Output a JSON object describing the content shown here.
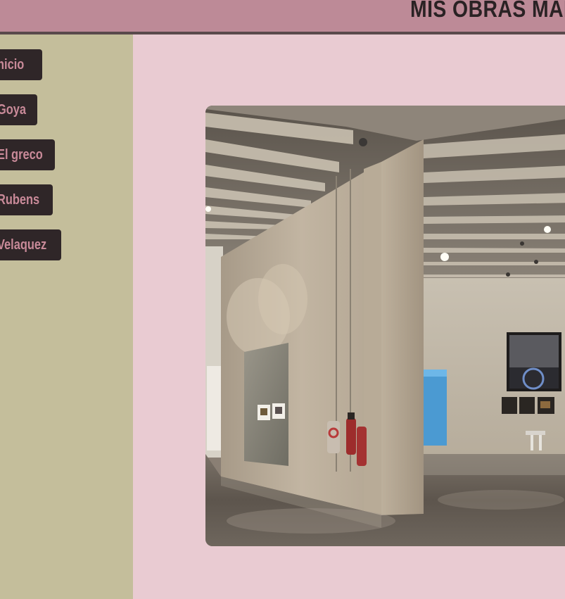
{
  "header": {
    "title": "MIS OBRAS MAE"
  },
  "sidebar": {
    "items": [
      {
        "label": "nicio"
      },
      {
        "label": "Goya"
      },
      {
        "label": "El greco"
      },
      {
        "label": "Rubens"
      },
      {
        "label": "Velaquez"
      }
    ]
  },
  "main": {
    "image": {
      "subject": "museum-gallery-photo"
    }
  },
  "colors": {
    "header_bg": "#bd8a97",
    "sidebar_bg": "#c4be9b",
    "main_bg": "#e9cbd2",
    "button_bg": "#2f2628",
    "button_text": "#c98a99"
  }
}
